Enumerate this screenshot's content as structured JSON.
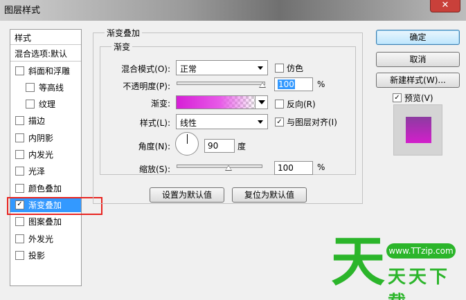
{
  "window": {
    "title": "图层样式",
    "close_label": "✕"
  },
  "styles_list": {
    "header": "样式",
    "blend_options": "混合选项:默认",
    "items": [
      {
        "label": "斜面和浮雕",
        "checked": false,
        "sub": false
      },
      {
        "label": "等高线",
        "checked": false,
        "sub": true
      },
      {
        "label": "纹理",
        "checked": false,
        "sub": true
      },
      {
        "label": "描边",
        "checked": false,
        "sub": false
      },
      {
        "label": "内阴影",
        "checked": false,
        "sub": false
      },
      {
        "label": "内发光",
        "checked": false,
        "sub": false
      },
      {
        "label": "光泽",
        "checked": false,
        "sub": false
      },
      {
        "label": "颜色叠加",
        "checked": false,
        "sub": false
      },
      {
        "label": "渐变叠加",
        "checked": true,
        "sub": false,
        "selected": true
      },
      {
        "label": "图案叠加",
        "checked": false,
        "sub": false
      },
      {
        "label": "外发光",
        "checked": false,
        "sub": false
      },
      {
        "label": "投影",
        "checked": false,
        "sub": false
      }
    ]
  },
  "gradient_overlay": {
    "group_title": "渐变叠加",
    "subgroup_title": "渐变",
    "blend_mode_label": "混合模式(O):",
    "blend_mode_value": "正常",
    "dither_label": "仿色",
    "opacity_label": "不透明度(P):",
    "opacity_value": "100",
    "opacity_unit": "%",
    "opacity_level": 1.0,
    "gradient_label": "渐变:",
    "reverse_label": "反向(R)",
    "style_label": "样式(L):",
    "style_value": "线性",
    "align_label": "与图层对齐(I)",
    "angle_label": "角度(N):",
    "angle_value": "90",
    "angle_unit": "度",
    "scale_label": "缩放(S):",
    "scale_value": "100",
    "scale_unit": "%",
    "scale_level": 0.5,
    "make_default_label": "设置为默认值",
    "reset_default_label": "复位为默认值",
    "gradient_colors": [
      "#d61fd6",
      "#e85ae8"
    ]
  },
  "actions": {
    "ok_label": "确定",
    "cancel_label": "取消",
    "new_style_label": "新建样式(W)...",
    "preview_label": "预览(V)"
  },
  "watermark": {
    "big_char": "天",
    "url": "www.TTzip.com",
    "text": "天天下载"
  },
  "colors": {
    "accent": "#3399ff",
    "highlight": "#e8231f",
    "brand": "#2bb52a"
  }
}
